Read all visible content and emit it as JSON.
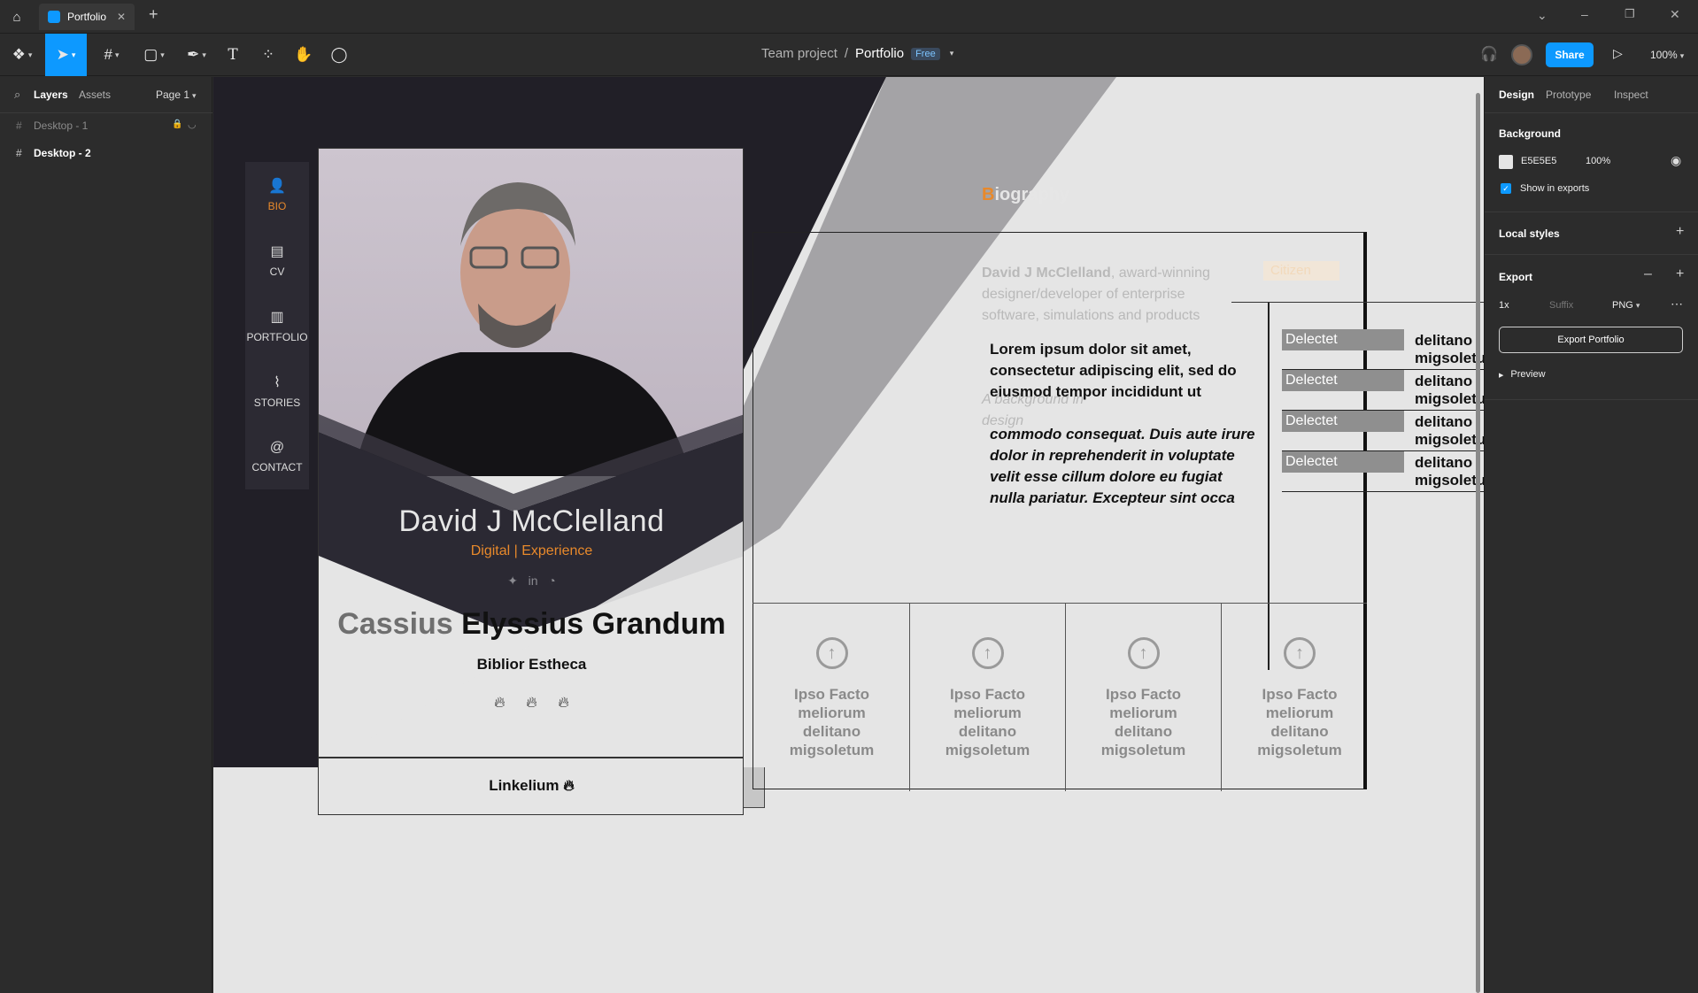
{
  "tabbar": {
    "tab_title": "Portfolio",
    "close_glyph": "✕",
    "add_glyph": "+",
    "window_controls": [
      "⌄",
      "–",
      "❐",
      "✕"
    ]
  },
  "toolbar": {
    "breadcrumb_team": "Team project",
    "breadcrumb_sep": "/",
    "file_name": "Portfolio",
    "plan_badge": "Free",
    "share_label": "Share",
    "zoom_label": "100%"
  },
  "left_panel": {
    "tab_layers": "Layers",
    "tab_assets": "Assets",
    "page_selector": "Page 1",
    "layers": [
      {
        "name": "Desktop - 1",
        "locked": true
      },
      {
        "name": "Desktop - 2",
        "locked": false
      }
    ]
  },
  "right_panel": {
    "tabs": [
      "Design",
      "Prototype",
      "Inspect"
    ],
    "background_title": "Background",
    "bg_hex": "E5E5E5",
    "bg_opacity": "100%",
    "show_in_exports": "Show in exports",
    "local_styles": "Local styles",
    "export_title": "Export",
    "export_scale": "1x",
    "export_suffix_placeholder": "Suffix",
    "export_format": "PNG",
    "export_button": "Export Portfolio",
    "preview_label": "Preview"
  },
  "canvas": {
    "nav": [
      {
        "label": "BIO",
        "icon": "person-icon",
        "glyph": "👤"
      },
      {
        "label": "CV",
        "icon": "document-icon",
        "glyph": "▤"
      },
      {
        "label": "PORTFOLIO",
        "icon": "book-icon",
        "glyph": "▥"
      },
      {
        "label": "STORIES",
        "icon": "pulse-icon",
        "glyph": "⌇"
      },
      {
        "label": "CONTACT",
        "icon": "at-icon",
        "glyph": "@"
      }
    ],
    "profile": {
      "name": "David J McClelland",
      "tagline": "Digital | Experience",
      "big_name_gray": "Cassius",
      "big_name_dark": "Elyssius Grandum",
      "subtitle": "Biblior Estheca",
      "footer": "Linkelium"
    },
    "bio": {
      "heading_first": "B",
      "heading_rest": "iography",
      "faded_name": "David J McClelland",
      "faded_text": ", award-winning designer/developer of enterprise software, simulations and products",
      "faded_extra": "A background in design",
      "faded_tag": "Citizen",
      "lorem_bold": "Lorem ipsum dolor sit amet, consectetur adipiscing elit, sed do eiusmod tempor incididunt ut",
      "lorem_italic": "commodo consequat. Duis aute irure dolor in reprehenderit in voluptate velit esse cillum dolore eu fugiat nulla pariatur. Excepteur sint occa",
      "rows": [
        {
          "label": "Delectet",
          "value": "delitano migsoletum"
        },
        {
          "label": "Delectet",
          "value": "delitano migsoletum"
        },
        {
          "label": "Delectet",
          "value": "delitano migsoletum"
        },
        {
          "label": "Delectet",
          "value": "delitano migsoletum"
        }
      ],
      "tiles": [
        "Ipso Facto meliorum delitano migsoletum",
        "Ipso Facto meliorum delitano migsoletum",
        "Ipso Facto meliorum delitano migsoletum",
        "Ipso Facto meliorum delitano migsoletum"
      ]
    }
  },
  "colors": {
    "accent_blue": "#0d99ff",
    "accent_orange": "#e8892b",
    "canvas_bg": "#e5e5e5"
  }
}
